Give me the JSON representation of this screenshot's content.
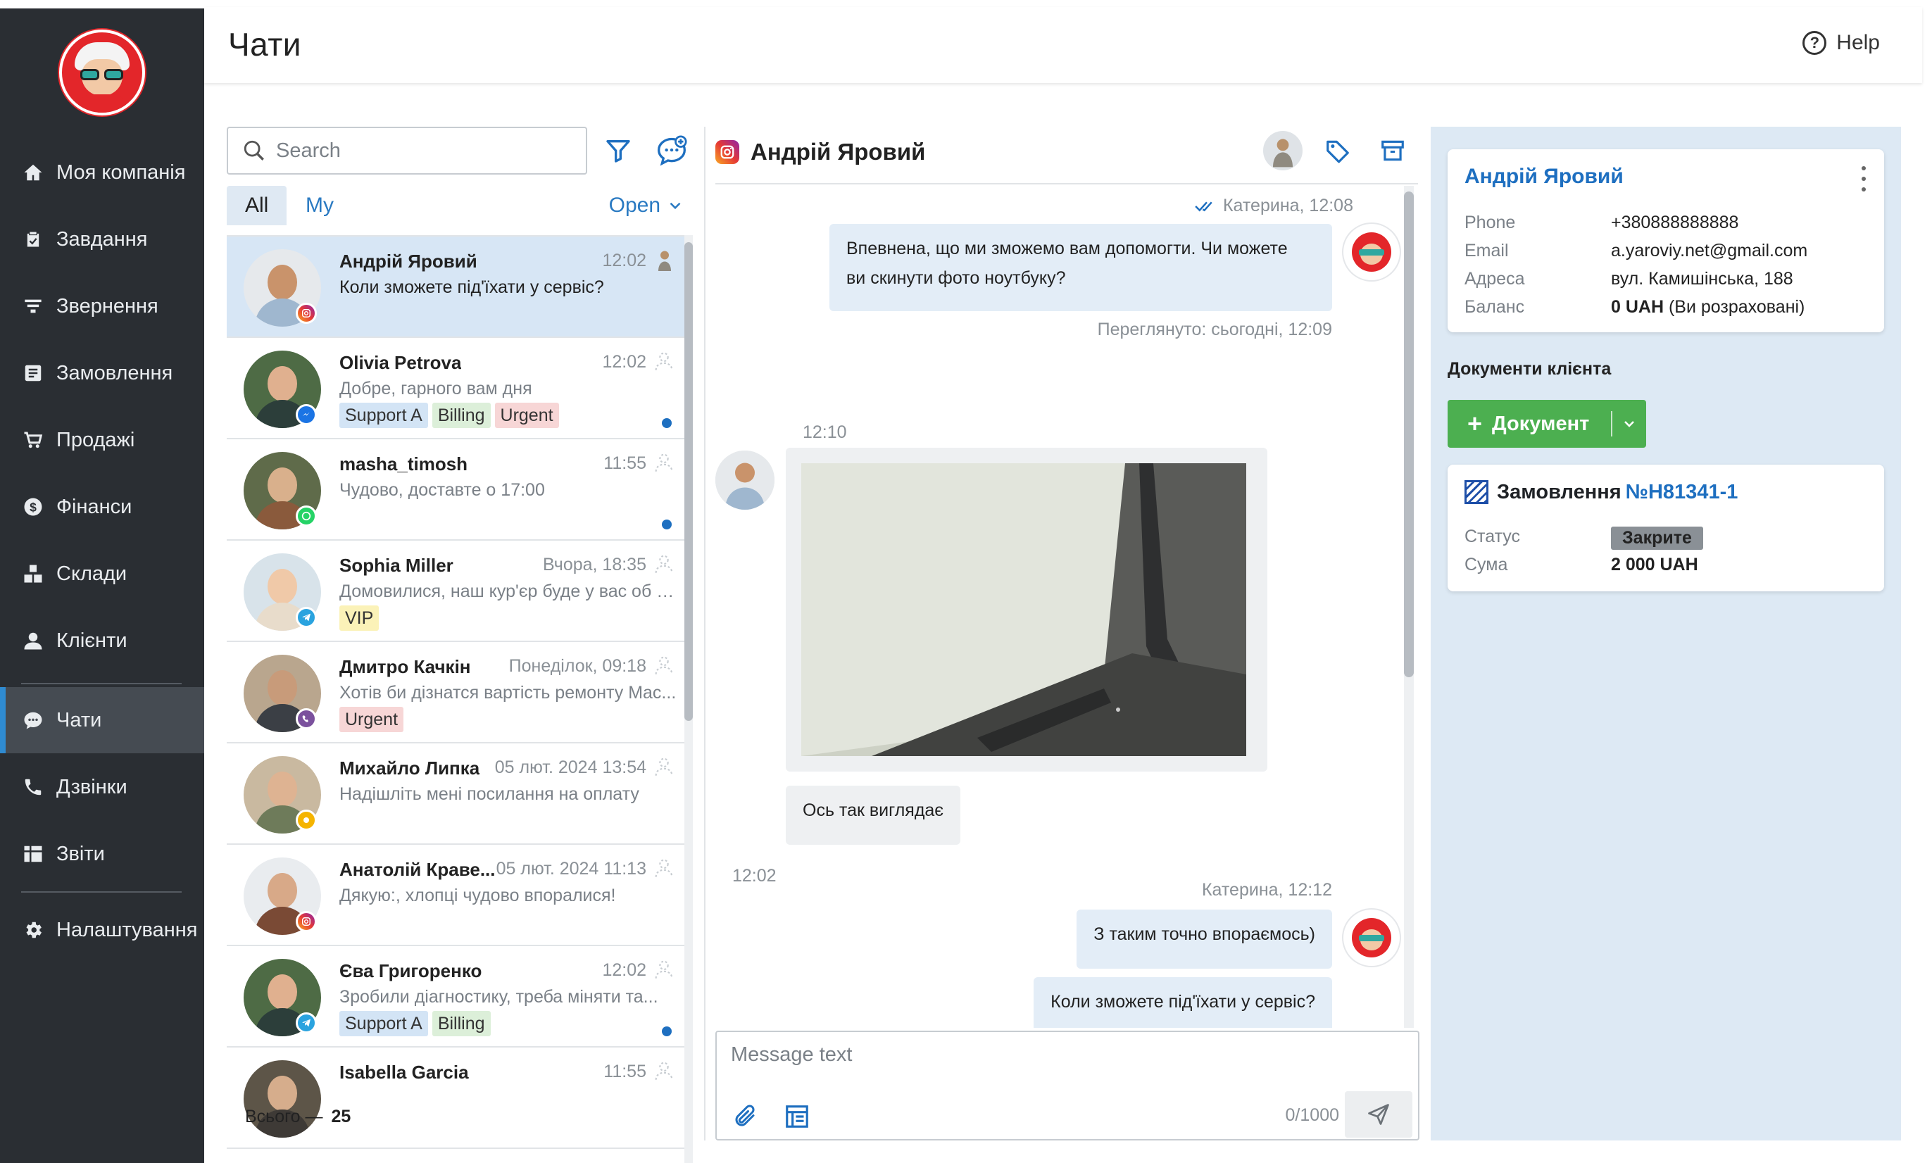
{
  "app": {
    "title": "Чати"
  },
  "header": {
    "help_label": "Help"
  },
  "sidebar": {
    "items": [
      {
        "label": "Моя компанія",
        "icon": "home-icon"
      },
      {
        "label": "Завдання",
        "icon": "clipboard-icon"
      },
      {
        "label": "Звернення",
        "icon": "funnel-icon"
      },
      {
        "label": "Замовлення",
        "icon": "receipt-icon"
      },
      {
        "label": "Продажі",
        "icon": "cart-icon"
      },
      {
        "label": "Фінанси",
        "icon": "dollar-icon"
      },
      {
        "label": "Склади",
        "icon": "boxes-icon"
      },
      {
        "label": "Клієнти",
        "icon": "user-icon"
      },
      {
        "label": "Чати",
        "icon": "chat-icon",
        "active": true
      },
      {
        "label": "Дзвінки",
        "icon": "phone-icon"
      },
      {
        "label": "Звіти",
        "icon": "table-icon"
      },
      {
        "label": "Налаштування",
        "icon": "gear-icon"
      }
    ]
  },
  "chatlist": {
    "search_placeholder": "Search",
    "tabs": [
      "All",
      "My"
    ],
    "active_tab": "All",
    "status_filter": "Open",
    "total_label": "Всього —",
    "total_count": "25",
    "items": [
      {
        "name": "Андрій Яровий",
        "time": "12:02",
        "message": "Коли зможете під'їхати у сервіс?",
        "channel": "instagram",
        "tags": [],
        "unread": false,
        "selected": true
      },
      {
        "name": "Olivia Petrova",
        "time": "12:02",
        "message": "Добре, гарного вам дня",
        "channel": "messenger",
        "tags": [
          "Support A",
          "Billing",
          "Urgent"
        ],
        "unread": true
      },
      {
        "name": "masha_timosh",
        "time": "11:55",
        "message": "Чудово, доставте о 17:00",
        "channel": "whatsapp",
        "tags": [],
        "unread": true
      },
      {
        "name": "Sophia Miller",
        "time": "Вчора, 18:35",
        "message": "Домовилися, наш кур'єр буде у вас об 1...",
        "channel": "telegram",
        "tags": [
          "VIP"
        ],
        "unread": false
      },
      {
        "name": "Дмитро Качкін",
        "time": "Понеділок, 09:18",
        "message": "Хотів би дізнатся вартість ремонту Mac...",
        "channel": "viber",
        "tags": [
          "Urgent"
        ],
        "unread": false
      },
      {
        "name": "Михайло Липка",
        "time": "05 лют. 2024 13:54",
        "message": "Надішліть мені посилання на оплату",
        "channel": "other",
        "tags": [],
        "unread": false
      },
      {
        "name": "Анатолій Краве...",
        "time": "05 лют. 2024 11:13",
        "message": "Дякую:, хлопці чудово впоралися!",
        "channel": "instagram",
        "tags": [],
        "unread": false
      },
      {
        "name": "Єва Григоренко",
        "time": "12:02",
        "message": "Зробили діагностику, треба міняти та...",
        "channel": "telegram",
        "tags": [
          "Support A",
          "Billing"
        ],
        "unread": true
      },
      {
        "name": "Isabella Garcia",
        "time": "11:55",
        "message": "",
        "channel": "",
        "tags": [],
        "unread": false
      }
    ]
  },
  "tag_colors": {
    "Support A": "#d3e4f5",
    "Billing": "#dcefd9",
    "Urgent": "#f7d6d6",
    "VIP": "#fbf2b8"
  },
  "conversation": {
    "contact_name": "Андрій Яровий",
    "messages": [
      {
        "meta": "Катерина, 12:08",
        "text_line1": "Впевнена, що ми зможемо вам допомогти. Чи можете",
        "text_line2": "ви скинути фото ноутбуку?",
        "seen": "Переглянуто: сьогодні, 12:09"
      },
      {
        "time": "12:10",
        "caption": "Ось так виглядає"
      },
      {
        "time": "12:02"
      },
      {
        "meta": "Катерина, 12:12",
        "text": "З таким точно впораємось)"
      },
      {
        "text": "Коли зможете під'їхати у сервіс?"
      }
    ],
    "composer": {
      "placeholder": "Message text",
      "counter": "0/1000"
    }
  },
  "client": {
    "name": "Андрій Яровий",
    "fields": [
      {
        "label": "Phone",
        "value": "+380888888888"
      },
      {
        "label": "Email",
        "value": "a.yaroviy.net@gmail.com"
      },
      {
        "label": "Адреса",
        "value": "вул. Камишінська, 188"
      },
      {
        "label": "Баланс",
        "value_bold": "0 UAH",
        "value_rest": " (Ви розраховані)"
      }
    ],
    "documents_title": "Документи клієнта",
    "document_button": "Документ",
    "order": {
      "title": "Замовлення",
      "number": "№H81341-1",
      "status_label": "Статус",
      "status_value": "Закрите",
      "sum_label": "Сума",
      "sum_value": "2 000 UAH"
    }
  }
}
